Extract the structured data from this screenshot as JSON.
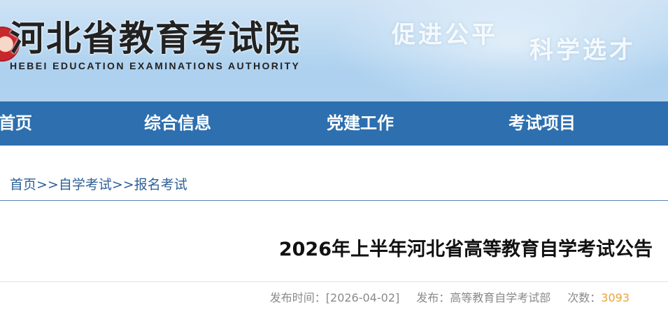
{
  "header": {
    "org_name_cn": "河北省教育考试院",
    "org_name_en": "HEBEI EDUCATION EXAMINATIONS AUTHORITY",
    "slogan_1": "促进公平",
    "slogan_2": "科学选才",
    "logo_icon": "emblem-icon"
  },
  "nav": {
    "items": [
      {
        "label": "首页"
      },
      {
        "label": "综合信息"
      },
      {
        "label": "党建工作"
      },
      {
        "label": "考试项目"
      }
    ],
    "bg_color": "#2d6faf"
  },
  "breadcrumb": {
    "items": [
      "首页",
      "自学考试",
      "报名考试"
    ],
    "separator": ">>"
  },
  "article": {
    "title": "2026年上半年河北省高等教育自学考试公告",
    "publish_time_label": "发布时间：",
    "publish_time": "[2026-04-02]",
    "publisher_label": "发布：",
    "publisher": "高等教育自学考试部",
    "views_label": "次数：",
    "views": "3093"
  },
  "colors": {
    "link": "#2d5f97",
    "count": "#e8a43a"
  }
}
